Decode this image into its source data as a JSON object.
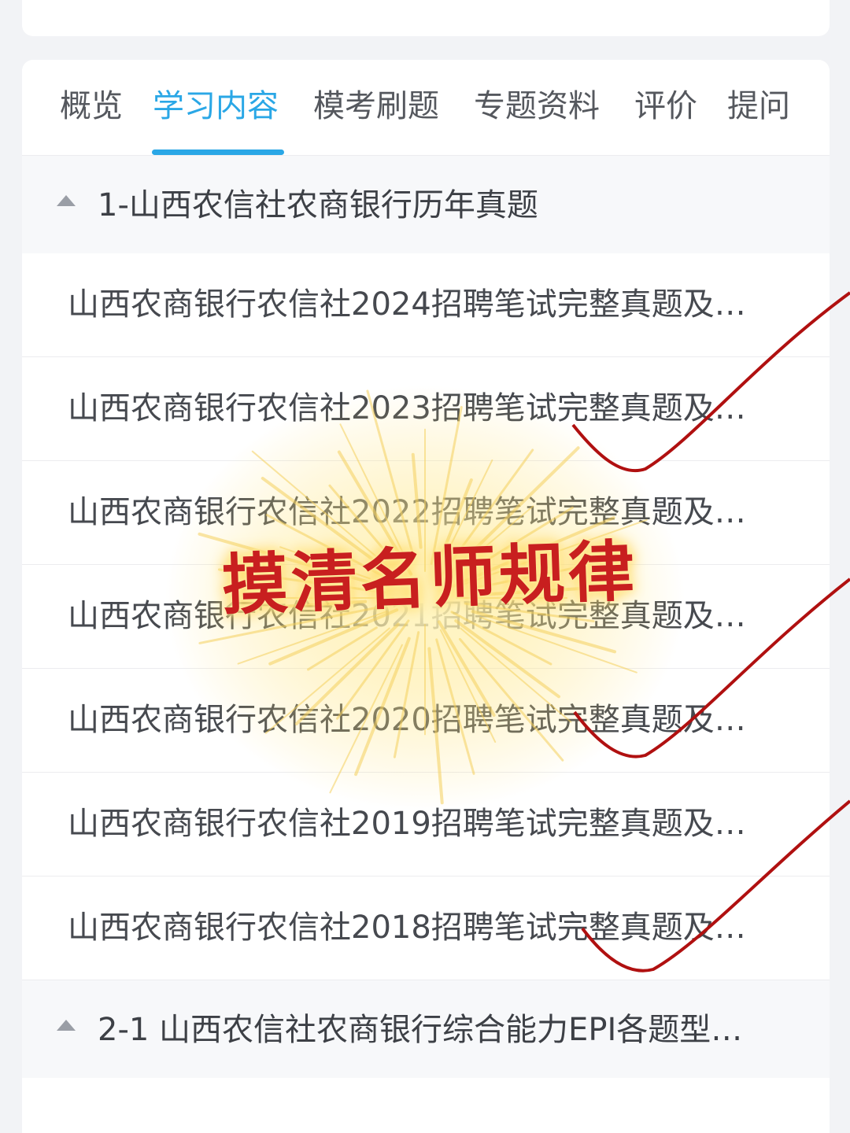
{
  "tabs": [
    {
      "label": "概览",
      "active": false
    },
    {
      "label": "学习内容",
      "active": true
    },
    {
      "label": "模考刷题",
      "active": false
    },
    {
      "label": "专题资料",
      "active": false
    },
    {
      "label": "评价",
      "active": false
    },
    {
      "label": "提问",
      "active": false
    }
  ],
  "section1": {
    "title": "1-山西农信社农商银行历年真题",
    "items": [
      "山西农商银行农信社2024招聘笔试完整真题及…",
      "山西农商银行农信社2023招聘笔试完整真题及…",
      "山西农商银行农信社2022招聘笔试完整真题及…",
      "山西农商银行农信社2021招聘笔试完整真题及…",
      "山西农商银行农信社2020招聘笔试完整真题及…",
      "山西农商银行农信社2019招聘笔试完整真题及…",
      "山西农商银行农信社2018招聘笔试完整真题及…"
    ]
  },
  "section2": {
    "title": "2-1 山西农信社农商银行综合能力EPI各题型…"
  },
  "overlay": {
    "slogan": "摸清名师规律",
    "slogan_color": "#c81f1f",
    "check_color": "#b01010"
  },
  "colors": {
    "accent": "#2aa7e6"
  }
}
